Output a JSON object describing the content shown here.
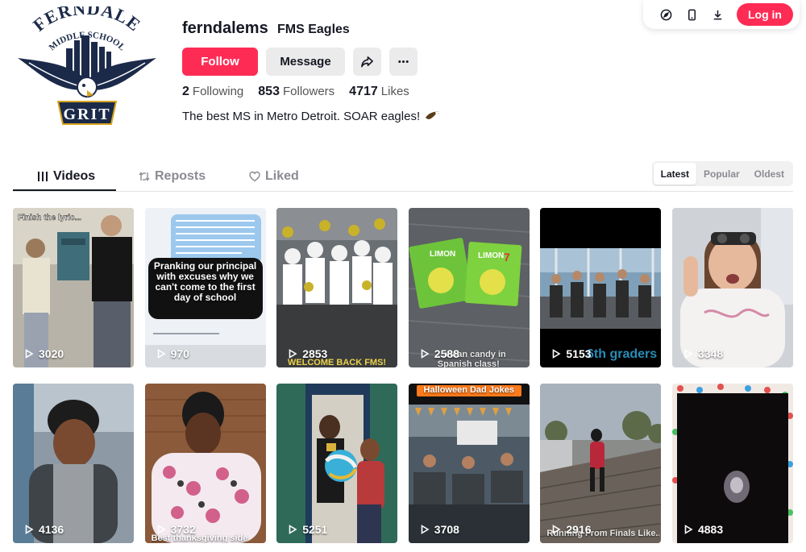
{
  "top_bar": {
    "icons": [
      "compass-icon",
      "mobile-icon",
      "download-icon"
    ],
    "login_label": "Log in"
  },
  "profile": {
    "username": "ferndalems",
    "nickname": "FMS Eagles",
    "avatar_text": {
      "top": "FERNDALE",
      "middle": "MIDDLE SCHOOL",
      "bottom": "GRIT"
    },
    "follow_label": "Follow",
    "message_label": "Message",
    "stats": [
      {
        "value": "2",
        "label": "Following"
      },
      {
        "value": "853",
        "label": "Followers"
      },
      {
        "value": "4717",
        "label": "Likes"
      }
    ],
    "bio": "The best MS in Metro Detroit. SOAR eagles!",
    "bio_emoji": "eagle-emoji"
  },
  "tabs": [
    {
      "label": "Videos",
      "icon": "grid-icon",
      "active": true
    },
    {
      "label": "Reposts",
      "icon": "repost-icon",
      "active": false
    },
    {
      "label": "Liked",
      "icon": "heart-icon",
      "active": false
    }
  ],
  "sort": [
    {
      "label": "Latest",
      "active": true
    },
    {
      "label": "Popular",
      "active": false
    },
    {
      "label": "Oldest",
      "active": false
    }
  ],
  "videos": [
    {
      "views": "3020",
      "overlay": "Finish the lyric..."
    },
    {
      "views": "970",
      "overlay": "Pranking our principal with excuses why we can't come to the first day of school"
    },
    {
      "views": "2853",
      "overlay": "WELCOME BACK FMS!"
    },
    {
      "views": "2588",
      "overlay": "...xican candy in Spanish class!"
    },
    {
      "views": "5153",
      "overlay": "6th graders"
    },
    {
      "views": "3348",
      "overlay": ""
    },
    {
      "views": "4136",
      "overlay": ""
    },
    {
      "views": "3732",
      "overlay": "Best thanksgiving side"
    },
    {
      "views": "5251",
      "overlay": ""
    },
    {
      "views": "3708",
      "overlay": "Halloween Dad Jokes"
    },
    {
      "views": "2916",
      "overlay": "Running From Finals Like..."
    },
    {
      "views": "4883",
      "overlay": ""
    }
  ],
  "colors": {
    "accent": "#fe2c55",
    "text": "#161823",
    "muted": "#8a8b91",
    "button_gray": "#ebebeb"
  }
}
